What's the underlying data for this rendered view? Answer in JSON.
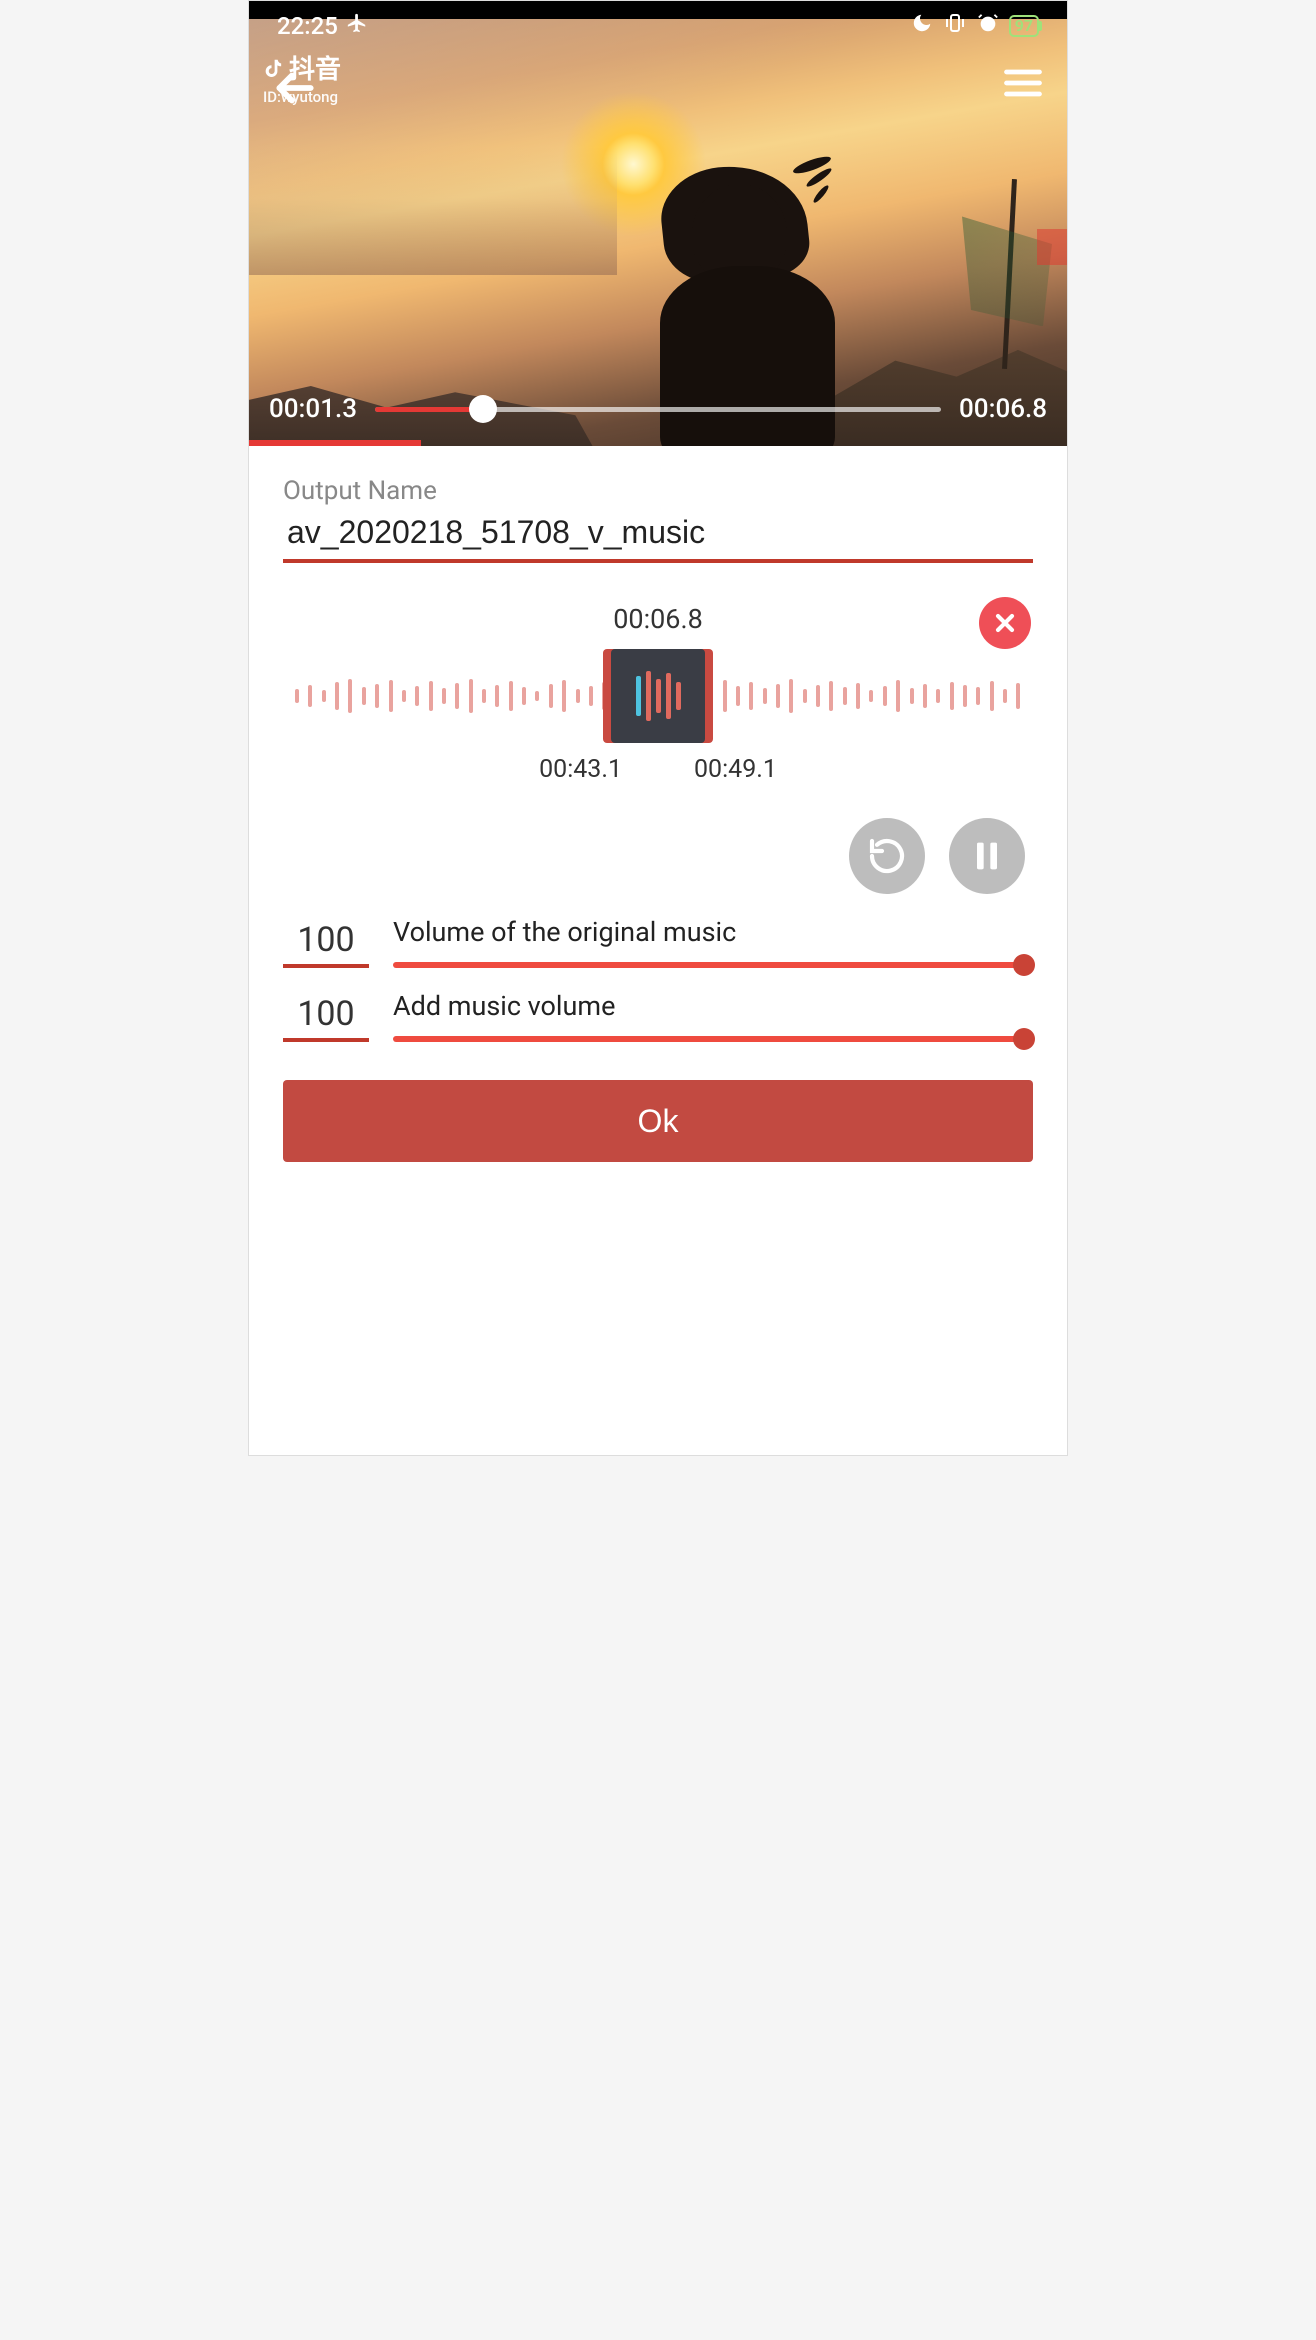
{
  "statusbar": {
    "time": "22:25",
    "battery": "97"
  },
  "watermark": {
    "brand": "抖音",
    "id_line": "ID:wyutong"
  },
  "video": {
    "current_time": "00:01.3",
    "total_time": "00:06.8",
    "progress_pct": 19
  },
  "output": {
    "label": "Output Name",
    "value": "av_2020218_51708_v_music"
  },
  "audio_clip": {
    "video_len": "00:06.8",
    "sel_start": "00:43.1",
    "sel_end": "00:49.1"
  },
  "volumes": {
    "original_label": "Volume of the original music",
    "original_value": "100",
    "music_label": "Add music volume",
    "music_value": "100"
  },
  "ok_label": "Ok",
  "colors": {
    "accent": "#c0392b",
    "slider": "#ef4b3f"
  }
}
